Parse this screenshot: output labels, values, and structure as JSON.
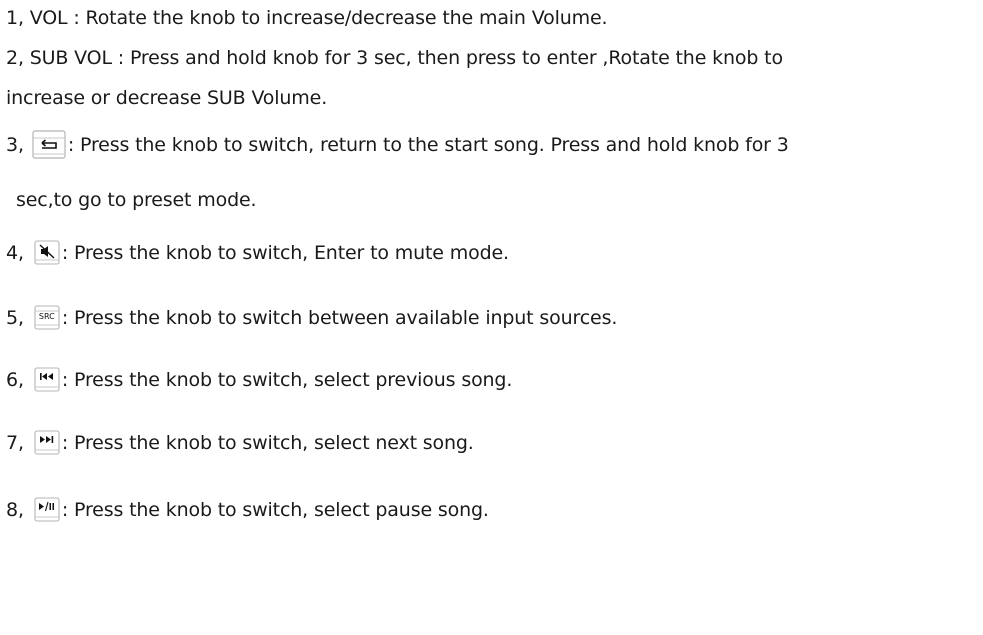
{
  "items": [
    {
      "number": "1,",
      "text": "VOL : Rotate the knob to increase/decrease the main Volume."
    },
    {
      "number": "2,",
      "text": "SUB VOL : Press and hold knob for 3 sec, then press to enter ,Rotate the knob to",
      "continuation": "increase or decrease SUB Volume."
    },
    {
      "number": "3,",
      "icon": "return-icon",
      "text": " : Press the knob to switch, return to the start song. Press and hold knob for 3",
      "continuation": "sec,to go to preset mode."
    },
    {
      "number": "4,",
      "icon": "mute-icon",
      "text": ": Press the knob to switch, Enter to mute mode."
    },
    {
      "number": "5,",
      "icon": "source-icon",
      "icon_text": "SRC",
      "text": ": Press the knob to switch between available input sources."
    },
    {
      "number": "6,",
      "icon": "previous-track-icon",
      "text": ": Press the knob to switch, select previous song."
    },
    {
      "number": "7,",
      "icon": "next-track-icon",
      "text": ": Press the knob to switch, select next song."
    },
    {
      "number": "8,",
      "icon": "play-pause-icon",
      "text": ": Press the knob to switch, select pause song."
    }
  ]
}
